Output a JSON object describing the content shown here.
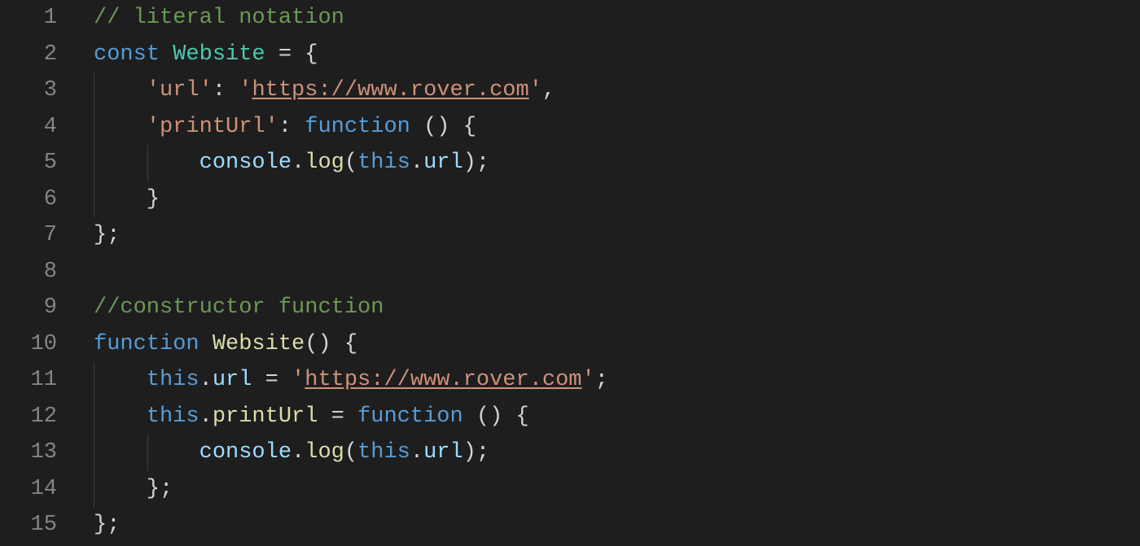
{
  "editor": {
    "lines": {
      "l1": {
        "num": "1"
      },
      "l2": {
        "num": "2"
      },
      "l3": {
        "num": "3"
      },
      "l4": {
        "num": "4"
      },
      "l5": {
        "num": "5"
      },
      "l6": {
        "num": "6"
      },
      "l7": {
        "num": "7"
      },
      "l8": {
        "num": "8"
      },
      "l9": {
        "num": "9"
      },
      "l10": {
        "num": "10"
      },
      "l11": {
        "num": "11"
      },
      "l12": {
        "num": "12"
      },
      "l13": {
        "num": "13"
      },
      "l14": {
        "num": "14"
      },
      "l15": {
        "num": "15"
      }
    },
    "tokens": {
      "comment_literal": "// literal notation",
      "const": "const",
      "space": " ",
      "Website": "Website",
      "eq": " = ",
      "lbrace": "{",
      "rbrace": "}",
      "lparen": "(",
      "rparen": ")",
      "semicolon": ";",
      "comma": ",",
      "colon": ": ",
      "indent1": "    ",
      "indent2": "        ",
      "sq": "'",
      "key_url": "url",
      "val_url_https": "https://www.rover.com",
      "key_printUrl": "printUrl",
      "function": "function",
      "space_paren": " () ",
      "console": "console",
      "dot": ".",
      "log": "log",
      "this": "this",
      "url": "url",
      "comment_constructor": "//constructor function",
      "printUrl": "printUrl",
      "eq2": " = "
    }
  }
}
